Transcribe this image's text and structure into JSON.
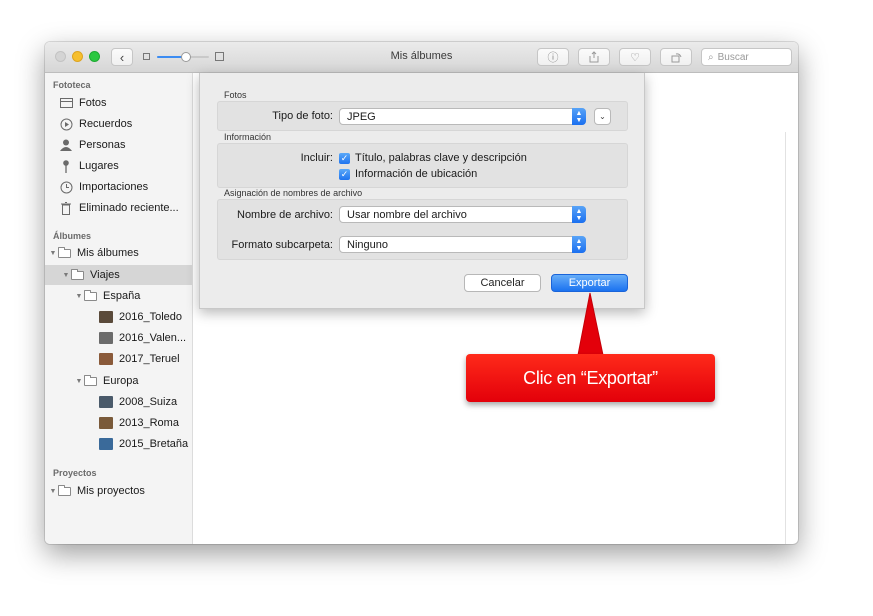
{
  "window": {
    "title": "Mis álbumes",
    "search_placeholder": "Buscar",
    "zoom_level": 0.55
  },
  "toolbar": {
    "back_icon": "chevron-left-icon",
    "buttons": [
      "info-icon",
      "share-icon",
      "heart-icon",
      "rotate-icon"
    ]
  },
  "sidebar": {
    "section_library": "Fototeca",
    "library_items": [
      {
        "label": "Fotos",
        "icon": "photos-icon"
      },
      {
        "label": "Recuerdos",
        "icon": "memories-icon"
      },
      {
        "label": "Personas",
        "icon": "person-icon"
      },
      {
        "label": "Lugares",
        "icon": "pin-icon"
      },
      {
        "label": "Importaciones",
        "icon": "clock-icon"
      },
      {
        "label": "Eliminado reciente...",
        "icon": "trash-icon"
      }
    ],
    "section_albums": "Álbumes",
    "album_items": [
      {
        "label": "Mis álbumes"
      },
      {
        "label": "Viajes",
        "selected": true
      },
      {
        "label": "España"
      },
      {
        "label": "2016_Toledo",
        "color": "#5a4a3a"
      },
      {
        "label": "2016_Valen...",
        "color": "#6b6b6b"
      },
      {
        "label": "2017_Teruel",
        "color": "#8a5a3a"
      },
      {
        "label": "Europa"
      },
      {
        "label": "2008_Suiza",
        "color": "#4a5a6a"
      },
      {
        "label": "2013_Roma",
        "color": "#7a5a3a"
      },
      {
        "label": "2015_Bretaña",
        "color": "#3a6a9a"
      }
    ],
    "section_projects": "Proyectos",
    "project_items": [
      {
        "label": "Mis proyectos"
      }
    ]
  },
  "export_sheet": {
    "section_photos": "Fotos",
    "photo_type_label": "Tipo de foto:",
    "photo_type_value": "JPEG",
    "section_info": "Información",
    "include_label": "Incluir:",
    "include_options": [
      {
        "label": "Título, palabras clave y descripción",
        "checked": true
      },
      {
        "label": "Información de ubicación",
        "checked": true
      }
    ],
    "section_naming": "Asignación de nombres de archivo",
    "filename_label": "Nombre de archivo:",
    "filename_value": "Usar nombre del archivo",
    "subfolder_label": "Formato subcarpeta:",
    "subfolder_value": "Ninguno",
    "cancel_label": "Cancelar",
    "export_label": "Exportar"
  },
  "callout": {
    "text": "Clic en “Exportar”",
    "color": "#e3000a"
  }
}
